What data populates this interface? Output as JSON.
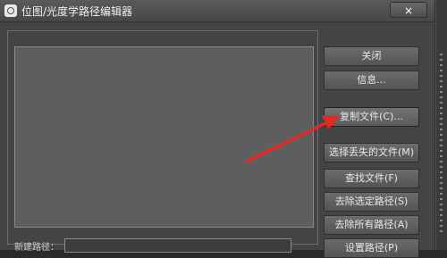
{
  "window": {
    "title": "位图/光度学路径编辑器",
    "close_label": "×"
  },
  "buttons": [
    {
      "label": "关闭"
    },
    {
      "label": "信息..."
    },
    {
      "label": "复制文件(C)..."
    },
    {
      "label": "选择丢失的文件(M)"
    },
    {
      "label": "查找文件(F)"
    },
    {
      "label": "去除选定路径(S)"
    },
    {
      "label": "去除所有路径(A)"
    },
    {
      "label": "设置路径(P)"
    }
  ],
  "bottom": {
    "label": "新建路径："
  },
  "annotation": {
    "arrow_color": "#e02a22"
  }
}
